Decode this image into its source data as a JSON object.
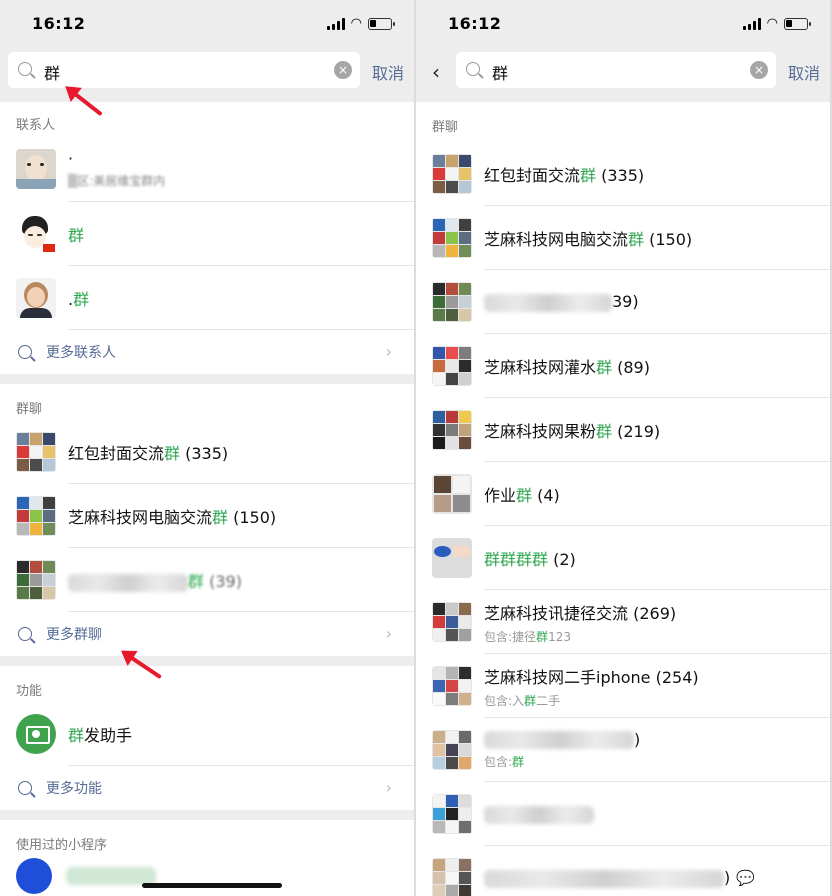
{
  "status": {
    "time": "16:12"
  },
  "left": {
    "search": {
      "query": "群",
      "clear": "×",
      "cancel": "取消"
    },
    "contacts": {
      "header": "联系人",
      "items": [
        {
          "name": "·",
          "sub": "▒区:美居维宝群内"
        },
        {
          "name_hl": "群"
        },
        {
          "name": ".",
          "name_hl": "群"
        }
      ],
      "more": "更多联系人"
    },
    "groups": {
      "header": "群聊",
      "items": [
        {
          "name": "红包封面交流",
          "name_hl": "群",
          "count": " (335)"
        },
        {
          "name": "芝麻科技网电脑交流",
          "name_hl": "群",
          "count": " (150)"
        },
        {
          "name_hl": "群",
          "count": " (39)"
        }
      ],
      "more": "更多群聊"
    },
    "functions": {
      "header": "功能",
      "items": [
        {
          "name_hl": "群",
          "name": "发助手"
        }
      ],
      "more": "更多功能"
    },
    "miniprograms": {
      "header": "使用过的小程序"
    }
  },
  "right": {
    "search": {
      "query": "群",
      "clear": "×",
      "cancel": "取消",
      "back": "‹"
    },
    "groups": {
      "header": "群聊",
      "items": [
        {
          "name": "红包封面交流",
          "name_hl": "群",
          "count": " (335)"
        },
        {
          "name": "芝麻科技网电脑交流",
          "name_hl": "群",
          "count": " (150)"
        },
        {
          "count": "39)"
        },
        {
          "name": "芝麻科技网灌水",
          "name_hl": "群",
          "count": " (89)"
        },
        {
          "name": "芝麻科技网果粉",
          "name_hl": "群",
          "count": " (219)"
        },
        {
          "name": "作业",
          "name_hl": "群",
          "count": " (4)"
        },
        {
          "name_hl": "群群群群",
          "count": " (2)"
        },
        {
          "name": "芝麻科技讯捷径交流 (269)",
          "sub": "包含:捷径",
          "sub_hl": "群",
          "sub_tail": "123"
        },
        {
          "name": "芝麻科技网二手iphone (254)",
          "sub": "包含:入",
          "sub_hl": "群",
          "sub_tail": "二手"
        },
        {
          "count": ")",
          "sub": "包含:",
          "sub_hl": "群"
        },
        {},
        {
          "count": ")"
        }
      ]
    }
  },
  "colors": {
    "highlight": "#2fa84f",
    "link": "#576b95",
    "arrow": "#e8192c"
  }
}
